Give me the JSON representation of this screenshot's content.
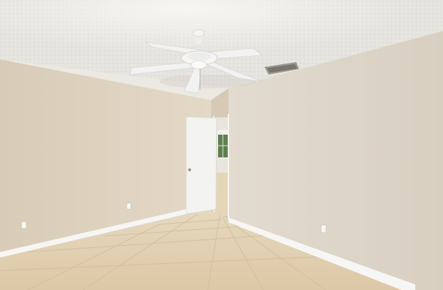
{
  "scene": {
    "subject": "empty-room-interior",
    "elements": [
      "textured-ceiling",
      "ceiling-fan",
      "air-vent",
      "left-wall",
      "right-wall",
      "open-door",
      "hallway",
      "window",
      "tile-floor",
      "baseboards",
      "wall-outlets"
    ]
  },
  "colors": {
    "ceiling": "#e6e4df",
    "ceiling_shadow": "#d6d3cd",
    "left_wall": "#ddd2bf",
    "right_wall": "#ddd5c8",
    "back_wall": "#d9cdb9",
    "floor": "#e3d2b3",
    "floor_grout": "#d2bf9f",
    "baseboard": "#f6f6f4",
    "door": "#f3f3f1",
    "fan": "#f2f2f2",
    "vent": "#8a8780",
    "window_green": "#5f7f52"
  }
}
